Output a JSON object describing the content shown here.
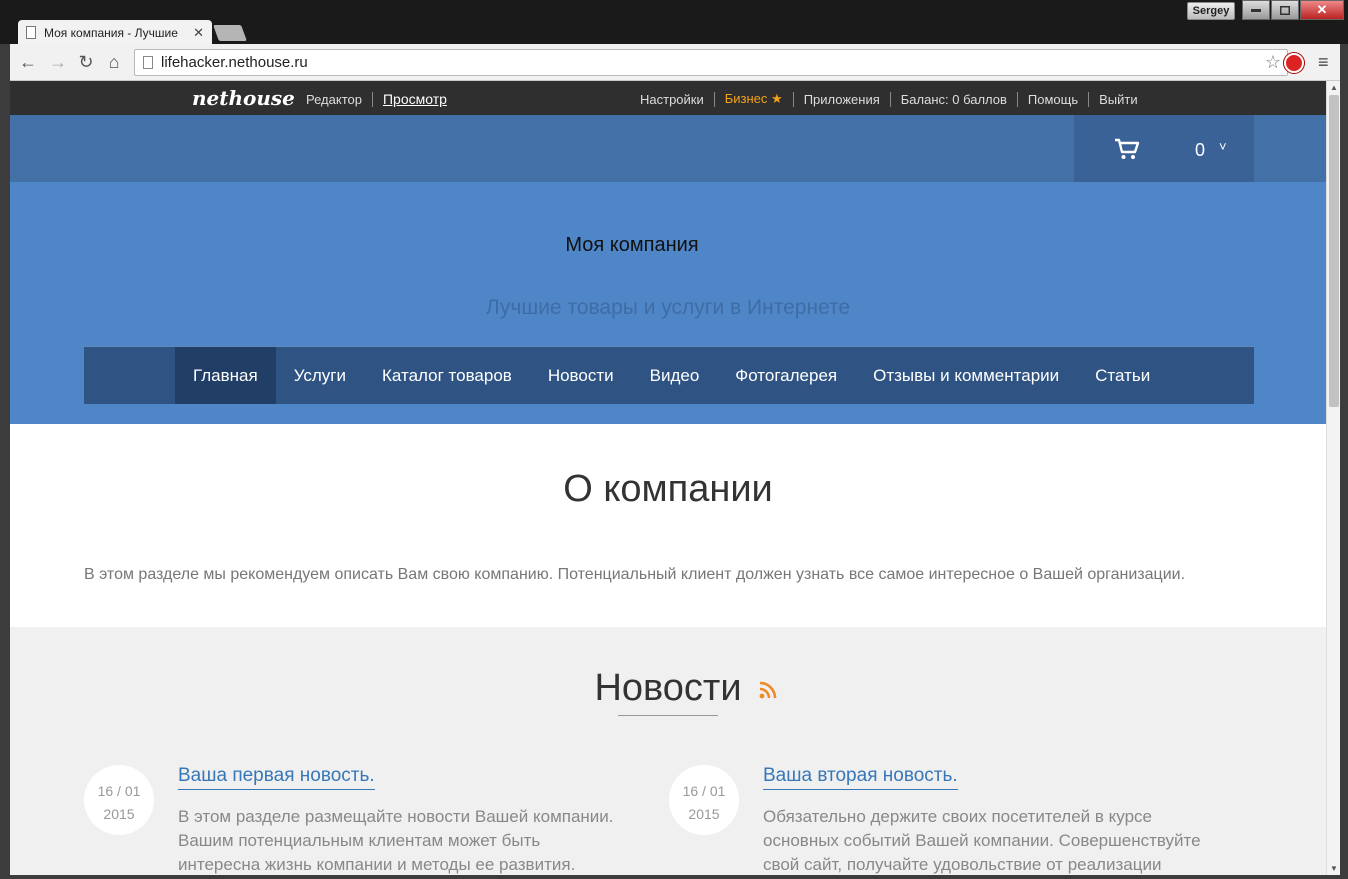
{
  "browser": {
    "tab_title": "Моя компания - Лучшие",
    "user": "Sergey",
    "url": "lifehacker.nethouse.ru"
  },
  "adminbar": {
    "logo": "nethouse",
    "mode_editor": "Редактор",
    "mode_view": "Просмотр",
    "settings": "Настройки",
    "business": "Бизнес ★",
    "apps": "Приложения",
    "balance": "Баланс: 0 баллов",
    "help": "Помощь",
    "logout": "Выйти"
  },
  "cart": {
    "count": "0",
    "chevron": "˅"
  },
  "hero": {
    "company_name": "Моя компания",
    "tagline": "Лучшие товары и услуги в Интернете"
  },
  "nav": {
    "items": [
      "Главная",
      "Услуги",
      "Каталог товаров",
      "Новости",
      "Видео",
      "Фотогалерея",
      "Отзывы и комментарии",
      "Статьи"
    ]
  },
  "about": {
    "title": "О компании",
    "text": "В этом разделе мы рекомендуем описать Вам свою компанию. Потенциальный клиент должен узнать все самое интересное о Вашей организации."
  },
  "news": {
    "title": "Новости",
    "items": [
      {
        "date": "16 / 01",
        "year": "2015",
        "title": "Ваша первая новость.",
        "text": "В этом разделе размещайте новости Вашей компании. Вашим потенциальным клиентам может быть интересна жизнь компании и методы ее развития. Удовлетворив их"
      },
      {
        "date": "16 / 01",
        "year": "2015",
        "title": "Ваша вторая новость.",
        "text": "Обязательно держите своих посетителей в курсе основных событий Вашей компании. Совершенствуйте свой сайт, получайте удовольствие от реализации своих"
      }
    ]
  },
  "colors": {
    "admin_bar": "#2f2f2f",
    "cart_strip": "#4470a8",
    "hero": "#4f86c8",
    "nav": "#2f5483",
    "nav_active": "#213f66",
    "business_accent": "#f4a21a",
    "link": "#3777b8",
    "rss": "#f08a24"
  },
  "icons": [
    "page-icon",
    "close-icon",
    "back-icon",
    "forward-icon",
    "reload-icon",
    "home-icon",
    "bookmark-star-icon",
    "adblock-icon",
    "menu-icon",
    "cart-icon",
    "chevron-down-icon",
    "rss-icon"
  ]
}
